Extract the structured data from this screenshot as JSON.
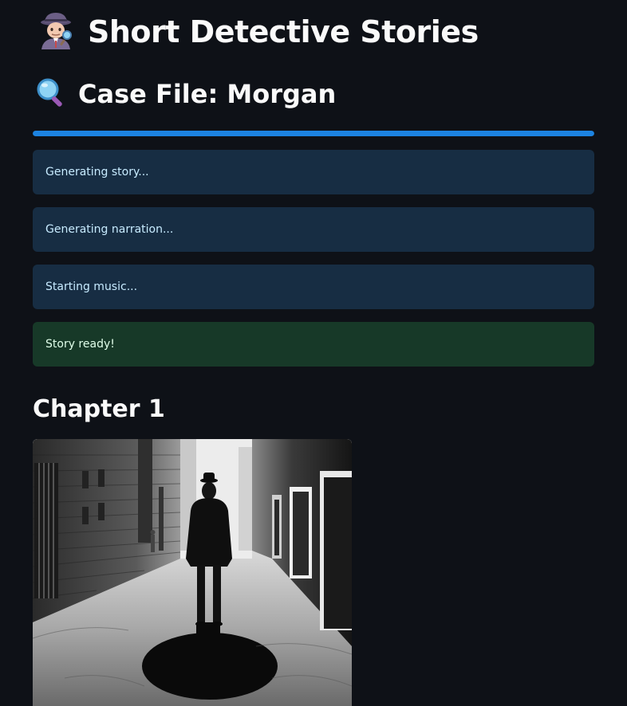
{
  "header": {
    "title": "Short Detective Stories",
    "title_icon": "detective-emoji-icon",
    "subtitle": "Case File: Morgan",
    "subtitle_icon": "magnifying-glass-icon"
  },
  "progress": {
    "value": 1.0,
    "color": "#1c83e1"
  },
  "status_messages": [
    {
      "type": "info",
      "text": "Generating story..."
    },
    {
      "type": "info",
      "text": "Generating narration..."
    },
    {
      "type": "info",
      "text": "Starting music..."
    },
    {
      "type": "success",
      "text": "Story ready!"
    }
  ],
  "chapter": {
    "heading": "Chapter 1",
    "image_alt_icon": "alley-scene-image"
  },
  "colors": {
    "background": "#0e1117",
    "info_bg": "#172d43",
    "success_bg": "#173928",
    "text": "#fafafa"
  }
}
